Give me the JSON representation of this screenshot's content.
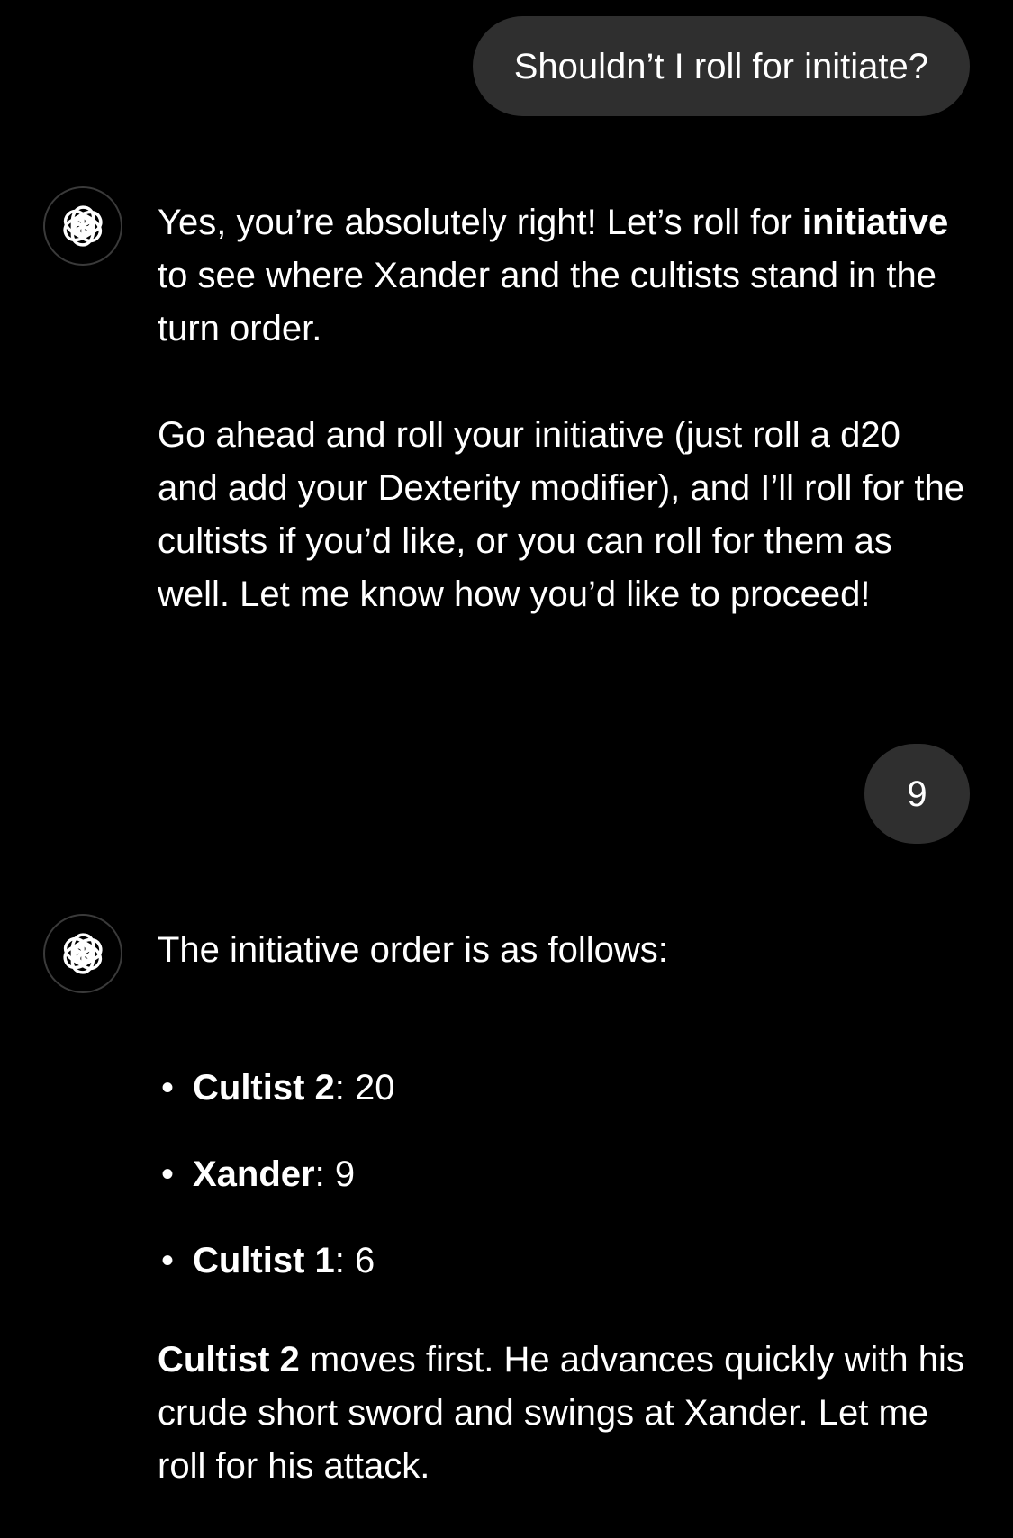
{
  "conversation": {
    "user_message_1": "Shouldn’t I roll for initiate?",
    "assistant_message_1": {
      "para1_prefix": "Yes, you’re absolutely right! Let’s roll for ",
      "para1_bold": "initiative",
      "para1_suffix": " to see where Xander and the cultists stand in the turn order.",
      "para2": "Go ahead and roll your initiative (just roll a d20 and add your Dexterity modifier), and I’ll roll for the cultists if you’d like, or you can roll for them as well. Let me know how you’d like to proceed!"
    },
    "user_message_2": "9",
    "assistant_message_2": {
      "intro": "The initiative order is as follows:",
      "initiative_list": [
        {
          "name": "Cultist 2",
          "value": ": 20"
        },
        {
          "name": "Xander",
          "value": ": 9"
        },
        {
          "name": "Cultist 1",
          "value": ": 6"
        }
      ],
      "final_bold": "Cultist 2",
      "final_text": " moves first. He advances quickly with his crude short sword and swings at Xander. Let me roll for his attack."
    }
  },
  "icons": {
    "assistant_avatar": "openai-logo-icon",
    "bullet": "•"
  },
  "colors": {
    "background": "#000000",
    "user_bubble": "#2f2f2f",
    "text": "#ffffff"
  }
}
